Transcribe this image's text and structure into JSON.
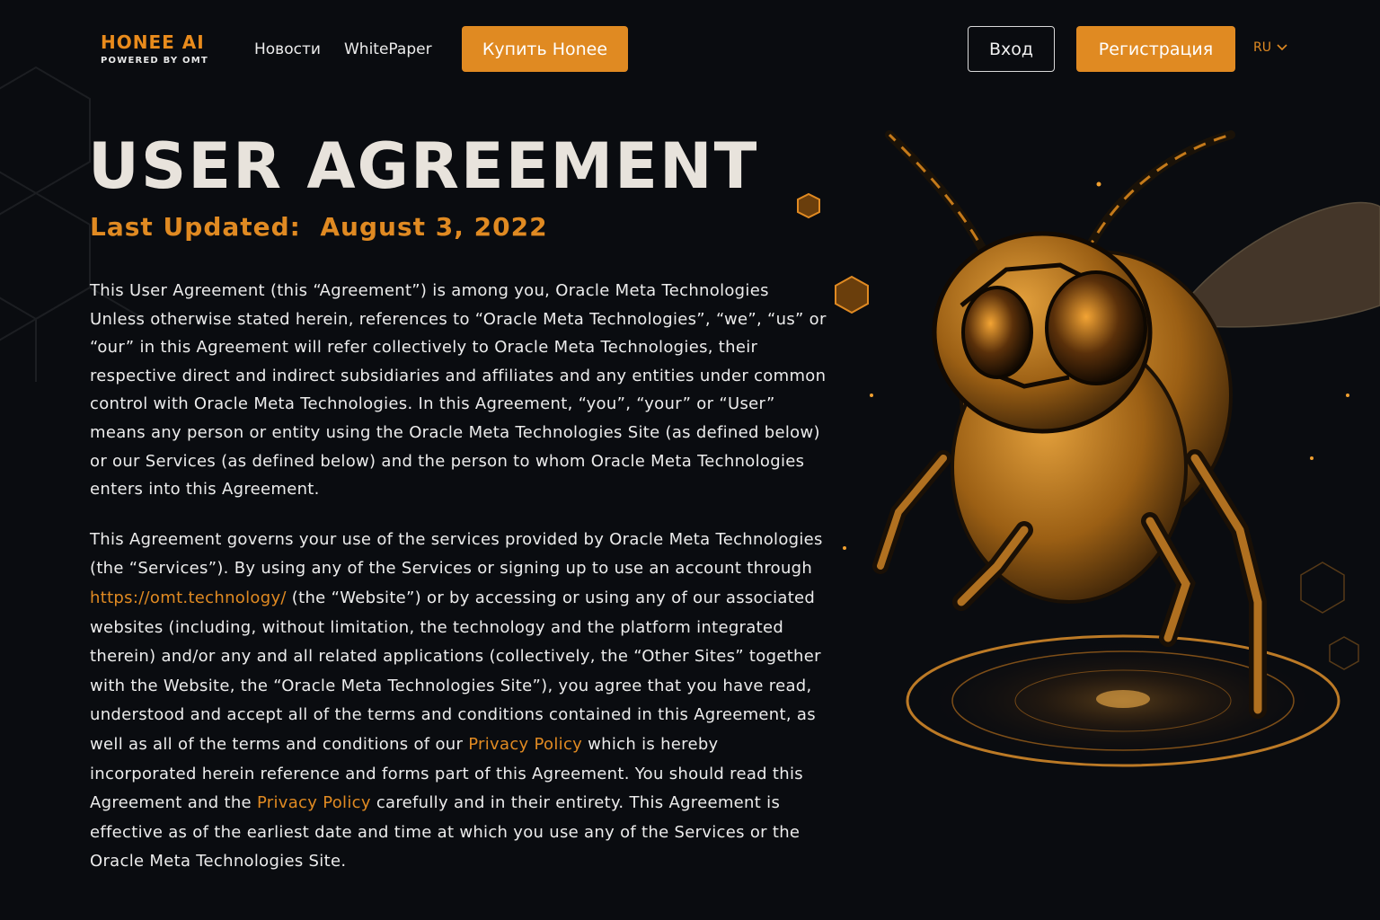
{
  "header": {
    "logo_title": "HONEE AI",
    "logo_sub": "POWERED BY OMT",
    "nav": {
      "news": "Новости",
      "whitepaper": "WhitePaper"
    },
    "buy_label": "Купить Honee",
    "login_label": "Вход",
    "register_label": "Регистрация",
    "language": "RU"
  },
  "main": {
    "title": "USER AGREEMENT",
    "updated_label": "Last Updated:",
    "updated_date": "August 3, 2022",
    "p1": "This User Agreement (this “Agreement”) is among you, Oracle Meta Technologies Unless otherwise stated herein, references to “Oracle Meta Technologies”, “we”, “us” or “our” in this Agreement will refer collectively to Oracle Meta Technologies, their respective direct and indirect subsidiaries and affiliates and any entities under common control with Oracle Meta Technologies. In this Agreement, “you”, “your” or “User” means any person or entity using the Oracle Meta Technologies Site (as defined below) or our Services (as defined below) and the person to whom Oracle Meta Technologies enters into this Agreement.",
    "p2": {
      "part1": "This Agreement governs your use of the services provided by Oracle Meta Technologies (the “Services”). By using any of the Services or signing up to use an account through ",
      "link_url": "https://omt.technology/",
      "part2": " (the “Website”) or by accessing or using any of our associated websites (including, without limitation, the technology and the platform integrated therein) and/or any and all related applications (collectively, the “Other Sites” together with the Website, the “Oracle Meta Technologies Site”), you agree that you have read, understood and accept all of the terms and conditions contained in this Agreement, as well as all of the terms and conditions of our ",
      "privacy_link_1": "Privacy Policy",
      "part3": " which is hereby incorporated herein reference and forms part of this Agreement. You should read this Agreement and the ",
      "privacy_link_2": "Privacy Policy",
      "part4": " carefully and in their entirety. This Agreement is effective as of the earliest date and time at which you use any of the Services or the Oracle Meta Technologies Site."
    }
  },
  "colors": {
    "accent": "#e08a22",
    "background": "#0a0c10",
    "text": "#ececec"
  },
  "icons": {
    "language_dropdown": "chevron-down-icon",
    "hero_art": "robot-bee-illustration"
  }
}
